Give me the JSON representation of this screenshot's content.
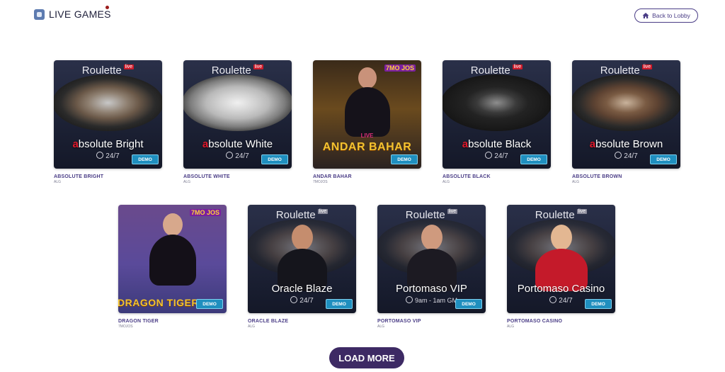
{
  "header": {
    "title": "LIVE GAMES",
    "back_label": "Back to Lobby"
  },
  "row1": [
    {
      "roulette": "Roulette",
      "live": "live",
      "name_accent": "a",
      "name_rest": "bsolute Bright",
      "avail": "24/7",
      "demo": "DEMO",
      "title": "ABSOLUTE BRIGHT",
      "provider": "ALG"
    },
    {
      "roulette": "Roulette",
      "live": "live",
      "name_accent": "a",
      "name_rest": "bsolute White",
      "avail": "24/7",
      "demo": "DEMO",
      "title": "ABSOLUTE WHITE",
      "provider": "ALG"
    },
    {
      "brand": "7MO JOS",
      "live_sub": "LIVE",
      "banner": "ANDAR BAHAR",
      "demo": "DEMO",
      "title": "ANDAR BAHAR",
      "provider": "7MOJOS"
    },
    {
      "roulette": "Roulette",
      "live": "live",
      "name_accent": "a",
      "name_rest": "bsolute Black",
      "avail": "24/7",
      "demo": "DEMO",
      "title": "ABSOLUTE BLACK",
      "provider": "ALG"
    },
    {
      "roulette": "Roulette",
      "live": "live",
      "name_accent": "a",
      "name_rest": "bsolute Brown",
      "avail": "24/7",
      "demo": "DEMO",
      "title": "ABSOLUTE BROWN",
      "provider": "ALG"
    }
  ],
  "row2": [
    {
      "brand": "7MO JOS",
      "banner": "DRAGON TIGER",
      "demo": "DEMO",
      "title": "DRAGON TIGER",
      "provider": "7MOJOS"
    },
    {
      "roulette": "Roulette",
      "live": "live",
      "name": "Oracle Blaze",
      "avail": "24/7",
      "demo": "DEMO",
      "title": "ORACLE BLAZE",
      "provider": "ALG"
    },
    {
      "roulette": "Roulette",
      "live": "live",
      "name": "Portomaso VIP",
      "avail": "9am - 1am GM",
      "demo": "DEMO",
      "title": "PORTOMASO VIP",
      "provider": "ALG"
    },
    {
      "roulette": "Roulette",
      "live": "live",
      "name": "Portomaso Casino",
      "avail": "24/7",
      "demo": "DEMO",
      "title": "PORTOMASO CASINO",
      "provider": "ALG"
    }
  ],
  "load_more": "LOAD MORE",
  "icons": {
    "logo": "live-games-icon",
    "home": "home-icon",
    "clock": "clock-icon"
  },
  "colors": {
    "accent": "#4a3d86",
    "demo": "#1f8fbf",
    "live_badge": "#cc1a2a",
    "load_more_bg": "#3d2a64"
  }
}
